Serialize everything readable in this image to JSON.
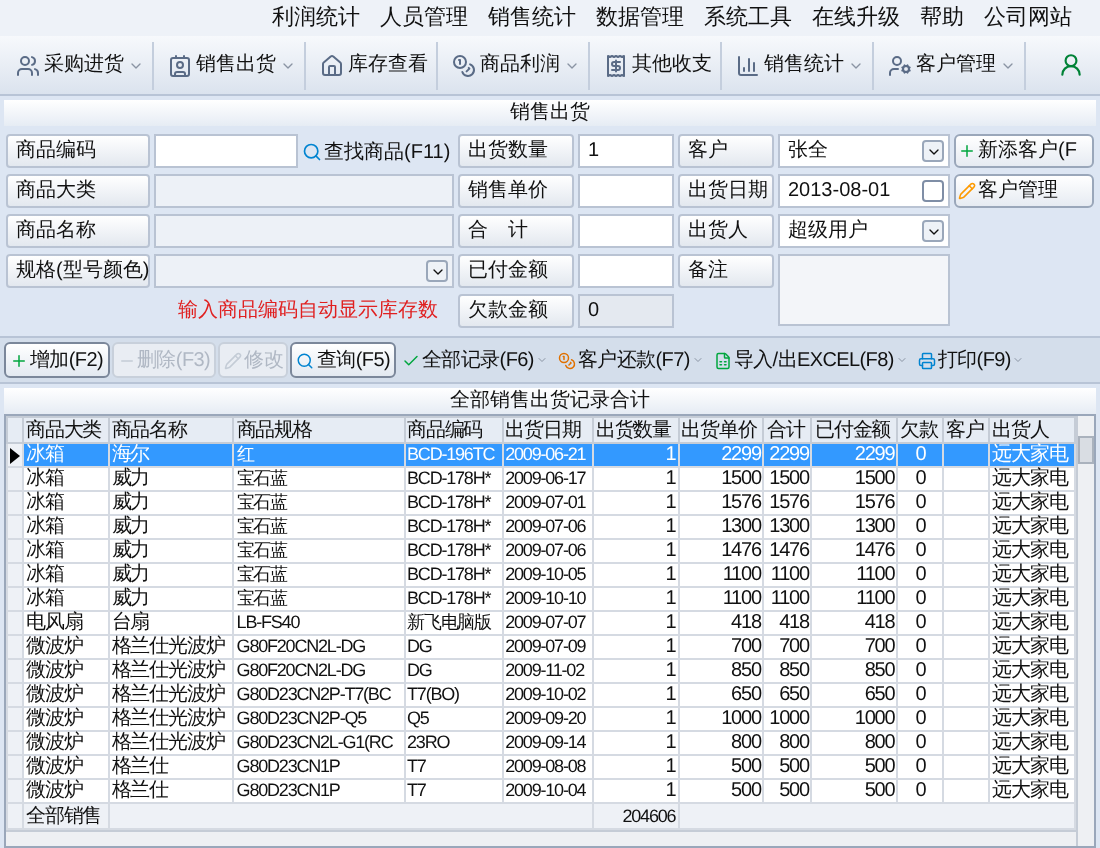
{
  "menu": [
    "利润统计",
    "人员管理",
    "销售统计",
    "数据管理",
    "系统工具",
    "在线升级",
    "帮助",
    "公司网站"
  ],
  "toolbar": [
    {
      "label": "采购进货",
      "dropdown": true
    },
    {
      "label": "销售出货",
      "dropdown": true
    },
    {
      "label": "库存查看",
      "dropdown": false
    },
    {
      "label": "商品利润",
      "dropdown": true
    },
    {
      "label": "其他收支",
      "dropdown": false
    },
    {
      "label": "销售统计",
      "dropdown": true
    },
    {
      "label": "客户管理",
      "dropdown": true
    }
  ],
  "panel_title": "销售出货",
  "form": {
    "left_fields": [
      {
        "label": "商品编码",
        "kind": "input"
      },
      {
        "label": "商品大类",
        "kind": "input"
      },
      {
        "label": "商品名称",
        "kind": "input"
      },
      {
        "label": "规格(型号颜色)",
        "kind": "select"
      }
    ],
    "search_button": "查找商品(F11)",
    "hint": "输入商品编码自动显示库存数",
    "middle_fields": [
      {
        "label": "出货数量",
        "value": "1",
        "readonly": false
      },
      {
        "label": "销售单价",
        "readonly": false
      },
      {
        "label": "合　计",
        "readonly": false
      },
      {
        "label": "已付金额",
        "readonly": false
      },
      {
        "label": "欠款金额",
        "value": "0",
        "readonly": true
      }
    ],
    "right_fields": [
      {
        "label": "客户",
        "kind": "select",
        "value": "张全"
      },
      {
        "label": "出货日期",
        "kind": "date",
        "value": "2013-08-01",
        "checked": false
      },
      {
        "label": "出货人",
        "kind": "select",
        "value": "超级用户"
      },
      {
        "label": "备注",
        "kind": "textarea"
      }
    ],
    "side_buttons": [
      "新添客户(F",
      "客户管理"
    ]
  },
  "actions": [
    {
      "label": "增加(F2)",
      "disabled": false,
      "dropdown": false
    },
    {
      "label": "删除(F3)",
      "disabled": true,
      "dropdown": false
    },
    {
      "label": "修改",
      "disabled": true,
      "dropdown": false
    },
    {
      "label": "查询(F5)",
      "disabled": false,
      "dropdown": false
    },
    {
      "label": "全部记录(F6)",
      "disabled": false,
      "dropdown": true
    },
    {
      "label": "客户还款(F7)",
      "disabled": false,
      "dropdown": true
    },
    {
      "label": "导入/出EXCEL(F8)",
      "disabled": false,
      "dropdown": true
    },
    {
      "label": "打印(F9)",
      "disabled": false,
      "dropdown": true
    }
  ],
  "grid": {
    "title": "全部销售出货记录合计",
    "columns": [
      "商品大类",
      "商品名称",
      "商品规格",
      "商品编码",
      "出货日期",
      "出货数量",
      "出货单价",
      "合计",
      "已付金额",
      "欠款",
      "客户",
      "出货人"
    ],
    "rows": [
      {
        "selected": true,
        "category": "冰箱",
        "name": "海尔",
        "spec": "红",
        "code": "BCD-196TC",
        "date": "2009-06-21",
        "qty": "1",
        "price": "2299",
        "total": "2299",
        "paid": "2299",
        "owed": "0",
        "seller": "远大家电"
      },
      {
        "selected": false,
        "category": "冰箱",
        "name": "威力",
        "spec": "宝石蓝",
        "code": "BCD-178H*",
        "date": "2009-06-17",
        "qty": "1",
        "price": "1500",
        "total": "1500",
        "paid": "1500",
        "owed": "0",
        "seller": "远大家电"
      },
      {
        "selected": false,
        "category": "冰箱",
        "name": "威力",
        "spec": "宝石蓝",
        "code": "BCD-178H*",
        "date": "2009-07-01",
        "qty": "1",
        "price": "1576",
        "total": "1576",
        "paid": "1576",
        "owed": "0",
        "seller": "远大家电"
      },
      {
        "selected": false,
        "category": "冰箱",
        "name": "威力",
        "spec": "宝石蓝",
        "code": "BCD-178H*",
        "date": "2009-07-06",
        "qty": "1",
        "price": "1300",
        "total": "1300",
        "paid": "1300",
        "owed": "0",
        "seller": "远大家电"
      },
      {
        "selected": false,
        "category": "冰箱",
        "name": "威力",
        "spec": "宝石蓝",
        "code": "BCD-178H*",
        "date": "2009-07-06",
        "qty": "1",
        "price": "1476",
        "total": "1476",
        "paid": "1476",
        "owed": "0",
        "seller": "远大家电"
      },
      {
        "selected": false,
        "category": "冰箱",
        "name": "威力",
        "spec": "宝石蓝",
        "code": "BCD-178H*",
        "date": "2009-10-05",
        "qty": "1",
        "price": "1100",
        "total": "1100",
        "paid": "1100",
        "owed": "0",
        "seller": "远大家电"
      },
      {
        "selected": false,
        "category": "冰箱",
        "name": "威力",
        "spec": "宝石蓝",
        "code": "BCD-178H*",
        "date": "2009-10-10",
        "qty": "1",
        "price": "1100",
        "total": "1100",
        "paid": "1100",
        "owed": "0",
        "seller": "远大家电"
      },
      {
        "selected": false,
        "category": "电风扇",
        "name": "台扇",
        "spec": "LB-FS40",
        "code": "新飞电脑版",
        "date": "2009-07-07",
        "qty": "1",
        "price": "418",
        "total": "418",
        "paid": "418",
        "owed": "0",
        "seller": "远大家电"
      },
      {
        "selected": false,
        "category": "微波炉",
        "name": "格兰仕光波炉",
        "spec": "G80F20CN2L-DG",
        "code": "DG",
        "date": "2009-07-09",
        "qty": "1",
        "price": "700",
        "total": "700",
        "paid": "700",
        "owed": "0",
        "seller": "远大家电"
      },
      {
        "selected": false,
        "category": "微波炉",
        "name": "格兰仕光波炉",
        "spec": "G80F20CN2L-DG",
        "code": "DG",
        "date": "2009-11-02",
        "qty": "1",
        "price": "850",
        "total": "850",
        "paid": "850",
        "owed": "0",
        "seller": "远大家电"
      },
      {
        "selected": false,
        "category": "微波炉",
        "name": "格兰仕光波炉",
        "spec": "G80D23CN2P-T7(BC",
        "code": "T7(BO)",
        "date": "2009-10-02",
        "qty": "1",
        "price": "650",
        "total": "650",
        "paid": "650",
        "owed": "0",
        "seller": "远大家电"
      },
      {
        "selected": false,
        "category": "微波炉",
        "name": "格兰仕光波炉",
        "spec": "G80D23CN2P-Q5",
        "code": "Q5",
        "date": "2009-09-20",
        "qty": "1",
        "price": "1000",
        "total": "1000",
        "paid": "1000",
        "owed": "0",
        "seller": "远大家电"
      },
      {
        "selected": false,
        "category": "微波炉",
        "name": "格兰仕光波炉",
        "spec": "G80D23CN2L-G1(RC",
        "code": "23RO",
        "date": "2009-09-14",
        "qty": "1",
        "price": "800",
        "total": "800",
        "paid": "800",
        "owed": "0",
        "seller": "远大家电"
      },
      {
        "selected": false,
        "category": "微波炉",
        "name": "格兰仕",
        "spec": "G80D23CN1P",
        "code": "T7",
        "date": "2009-08-08",
        "qty": "1",
        "price": "500",
        "total": "500",
        "paid": "500",
        "owed": "0",
        "seller": "远大家电"
      },
      {
        "selected": false,
        "category": "微波炉",
        "name": "格兰仕",
        "spec": "G80D23CN1P",
        "code": "T7",
        "date": "2009-10-04",
        "qty": "1",
        "price": "500",
        "total": "500",
        "paid": "500",
        "owed": "0",
        "seller": "远大家电"
      }
    ],
    "totals": {
      "label": "全部销售",
      "quantity": "204606"
    }
  }
}
